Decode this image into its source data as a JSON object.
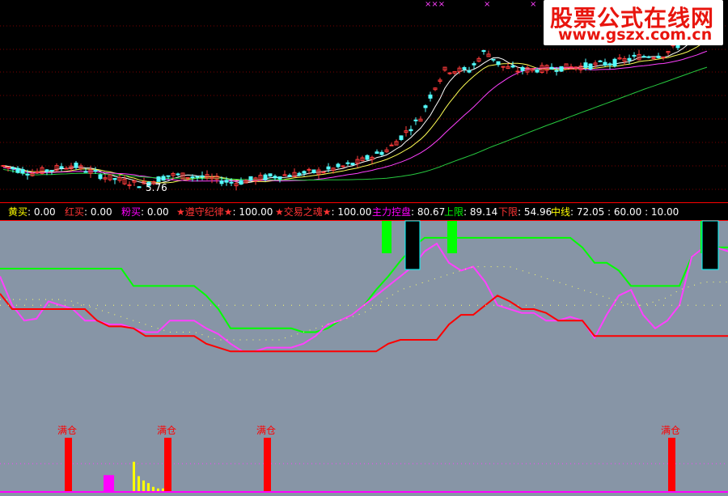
{
  "watermark": {
    "title": "股票公式在线网",
    "url": "www.gszx.com.cn"
  },
  "stats": [
    {
      "label": "黄买",
      "value": "0.00",
      "color": "#ffff00",
      "sep": ": "
    },
    {
      "label": "红买",
      "value": "0.00",
      "color": "#ff3333",
      "sep": ": "
    },
    {
      "label": "粉买",
      "value": "0.00",
      "color": "#ff00ff",
      "sep": ": "
    },
    {
      "label": "★遵守纪律★",
      "value": "100.00",
      "color": "#ff3333",
      "sep": ": "
    },
    {
      "label": "★交易之魂★",
      "value": "100.00",
      "color": "#ff3333",
      "sep": ": "
    },
    {
      "label": "主力控盘",
      "value": "80.67",
      "color": "#ff00ff",
      "sep": ": "
    },
    {
      "label": "上限",
      "value": "89.14",
      "color": "#00ff00",
      "sep": ": "
    },
    {
      "label": "下限",
      "value": "54.96",
      "color": "#ff3333",
      "sep": ": "
    },
    {
      "label": "中线",
      "value": "72.05 : 60.00 : 10.00",
      "color": "#ffff00",
      "sep": ": "
    }
  ],
  "colors": {
    "up_candle": "#ff3b3b",
    "down_candle": "#54ffff",
    "ma_white": "#ffffff",
    "ma_yellow": "#ffff55",
    "ma_magenta": "#ff40ff",
    "ma_green": "#27c93f",
    "panel_bg": "#8795a6",
    "upper_band": "#00ff00",
    "lower_band": "#ff0000",
    "control": "#ff40ff",
    "mid": "#ffff66",
    "full_bar": "#ff0000"
  },
  "chart_data": [
    {
      "type": "candlestick",
      "title": "",
      "low_label": "5.76",
      "markers": [
        "×××",
        "×",
        "×"
      ],
      "ylim": [
        5.5,
        10.5
      ]
    },
    {
      "type": "line",
      "title": "",
      "ylim": [
        0,
        100
      ],
      "x": [
        0,
        15,
        30,
        45,
        60,
        75,
        90,
        105,
        120,
        135,
        150,
        165,
        180,
        195,
        210,
        225,
        240,
        255,
        270,
        285,
        300,
        315,
        330,
        345,
        360,
        375,
        390,
        405,
        420,
        435,
        450,
        465,
        480,
        495,
        510,
        525,
        540,
        555,
        570,
        585,
        600,
        615,
        630,
        645,
        660,
        675,
        690,
        705,
        720,
        735,
        750,
        765,
        780,
        795,
        810,
        825,
        840,
        855,
        870,
        885,
        900
      ],
      "series": [
        {
          "name": "上限",
          "values": [
            79,
            79,
            79,
            79,
            79,
            79,
            79,
            79,
            79,
            79,
            79,
            70,
            70,
            70,
            70,
            70,
            70,
            65,
            58,
            48,
            48,
            48,
            48,
            48,
            48,
            46,
            46,
            48,
            52,
            55,
            60,
            68,
            75,
            83,
            90,
            95,
            95,
            95,
            95,
            95,
            95,
            95,
            95,
            95,
            95,
            95,
            95,
            95,
            90,
            82,
            82,
            78,
            70,
            70,
            70,
            70,
            70,
            85,
            90,
            90,
            90
          ]
        },
        {
          "name": "主力控盘",
          "values": [
            75,
            60,
            52,
            53,
            62,
            60,
            58,
            52,
            52,
            50,
            50,
            48,
            46,
            46,
            52,
            52,
            52,
            48,
            45,
            40,
            36,
            36,
            38,
            38,
            38,
            40,
            44,
            50,
            52,
            55,
            60,
            65,
            70,
            75,
            80,
            88,
            92,
            82,
            78,
            80,
            72,
            60,
            58,
            56,
            56,
            52,
            52,
            54,
            52,
            43,
            55,
            65,
            68,
            55,
            48,
            52,
            60,
            85,
            90,
            90,
            88
          ]
        },
        {
          "name": "下限",
          "values": [
            66,
            58,
            58,
            58,
            58,
            58,
            58,
            58,
            52,
            49,
            49,
            48,
            44,
            44,
            44,
            44,
            44,
            40,
            38,
            36,
            36,
            36,
            36,
            36,
            36,
            36,
            36,
            36,
            36,
            36,
            36,
            36,
            40,
            42,
            42,
            42,
            42,
            50,
            55,
            55,
            60,
            65,
            62,
            58,
            58,
            56,
            52,
            52,
            52,
            44,
            44,
            44,
            44,
            44,
            44,
            44,
            44,
            44,
            44,
            44,
            44
          ]
        },
        {
          "name": "中线",
          "values": [
            63,
            63,
            63,
            63,
            63,
            63,
            62,
            60,
            58,
            56,
            54,
            52,
            50,
            48,
            46,
            46,
            46,
            44,
            42,
            42,
            42,
            42,
            42,
            42,
            44,
            46,
            48,
            50,
            52,
            54,
            56,
            60,
            64,
            68,
            70,
            72,
            74,
            76,
            78,
            80,
            80,
            80,
            80,
            78,
            76,
            74,
            72,
            70,
            68,
            66,
            64,
            62,
            60,
            60,
            62,
            64,
            68,
            70,
            72,
            72,
            72
          ]
        },
        {
          "name": "中线-60",
          "values": [
            60,
            60,
            60,
            60,
            60,
            60,
            60,
            60,
            60,
            60,
            60,
            60,
            60,
            60,
            60,
            60,
            60,
            60,
            60,
            60,
            60,
            60,
            60,
            60,
            60,
            60,
            60,
            60,
            60,
            60,
            60,
            60,
            60,
            60,
            60,
            60,
            60,
            60,
            60,
            60,
            60,
            60,
            60,
            60,
            60,
            60,
            60,
            60,
            60,
            60,
            60,
            60,
            60,
            60,
            60,
            60,
            60,
            60,
            60,
            60,
            60
          ]
        }
      ]
    },
    {
      "type": "bar",
      "title": "",
      "label": "满仓",
      "series": [
        {
          "name": "满仓",
          "x": [
            84,
            207,
            330,
            830
          ],
          "values": [
            1,
            1,
            1,
            1
          ]
        },
        {
          "name": "粉买",
          "x": [
            134
          ],
          "values": [
            0.3
          ]
        },
        {
          "name": "黄买",
          "x": [
            165,
            171,
            177,
            183,
            189,
            195,
            201
          ],
          "values": [
            0.55,
            0.28,
            0.2,
            0.15,
            0.08,
            0.05,
            0.05
          ]
        }
      ]
    }
  ]
}
